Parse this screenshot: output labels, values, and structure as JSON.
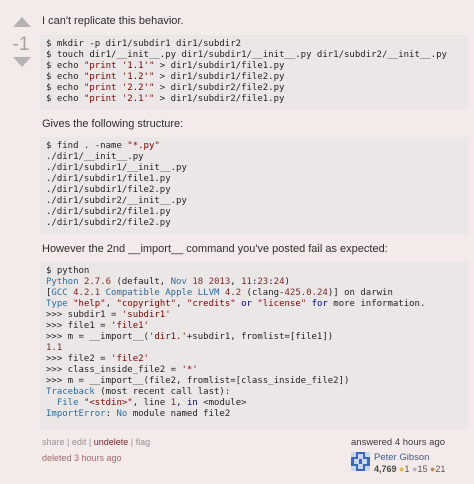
{
  "vote": {
    "count": "-1"
  },
  "intro": "I can't replicate this behavior.",
  "structure_text": "Gives the following structure:",
  "import_text": "However the 2nd __import__ command you've posted fail as expected:",
  "menu": {
    "share": "share",
    "edit": "edit",
    "undelete": "undelete",
    "flag": "flag"
  },
  "deleted": "deleted 3 hours ago",
  "signature": {
    "action": "answered 4 hours ago",
    "user_name": "Peter Gibson",
    "reputation": "4,769",
    "gold": "1",
    "silver": "15",
    "bronze": "21"
  },
  "colors": {
    "deleted_bg": "#f4eaea",
    "code_bg": "#ece7e7",
    "string": "#800000",
    "keyword": "#00008b"
  }
}
